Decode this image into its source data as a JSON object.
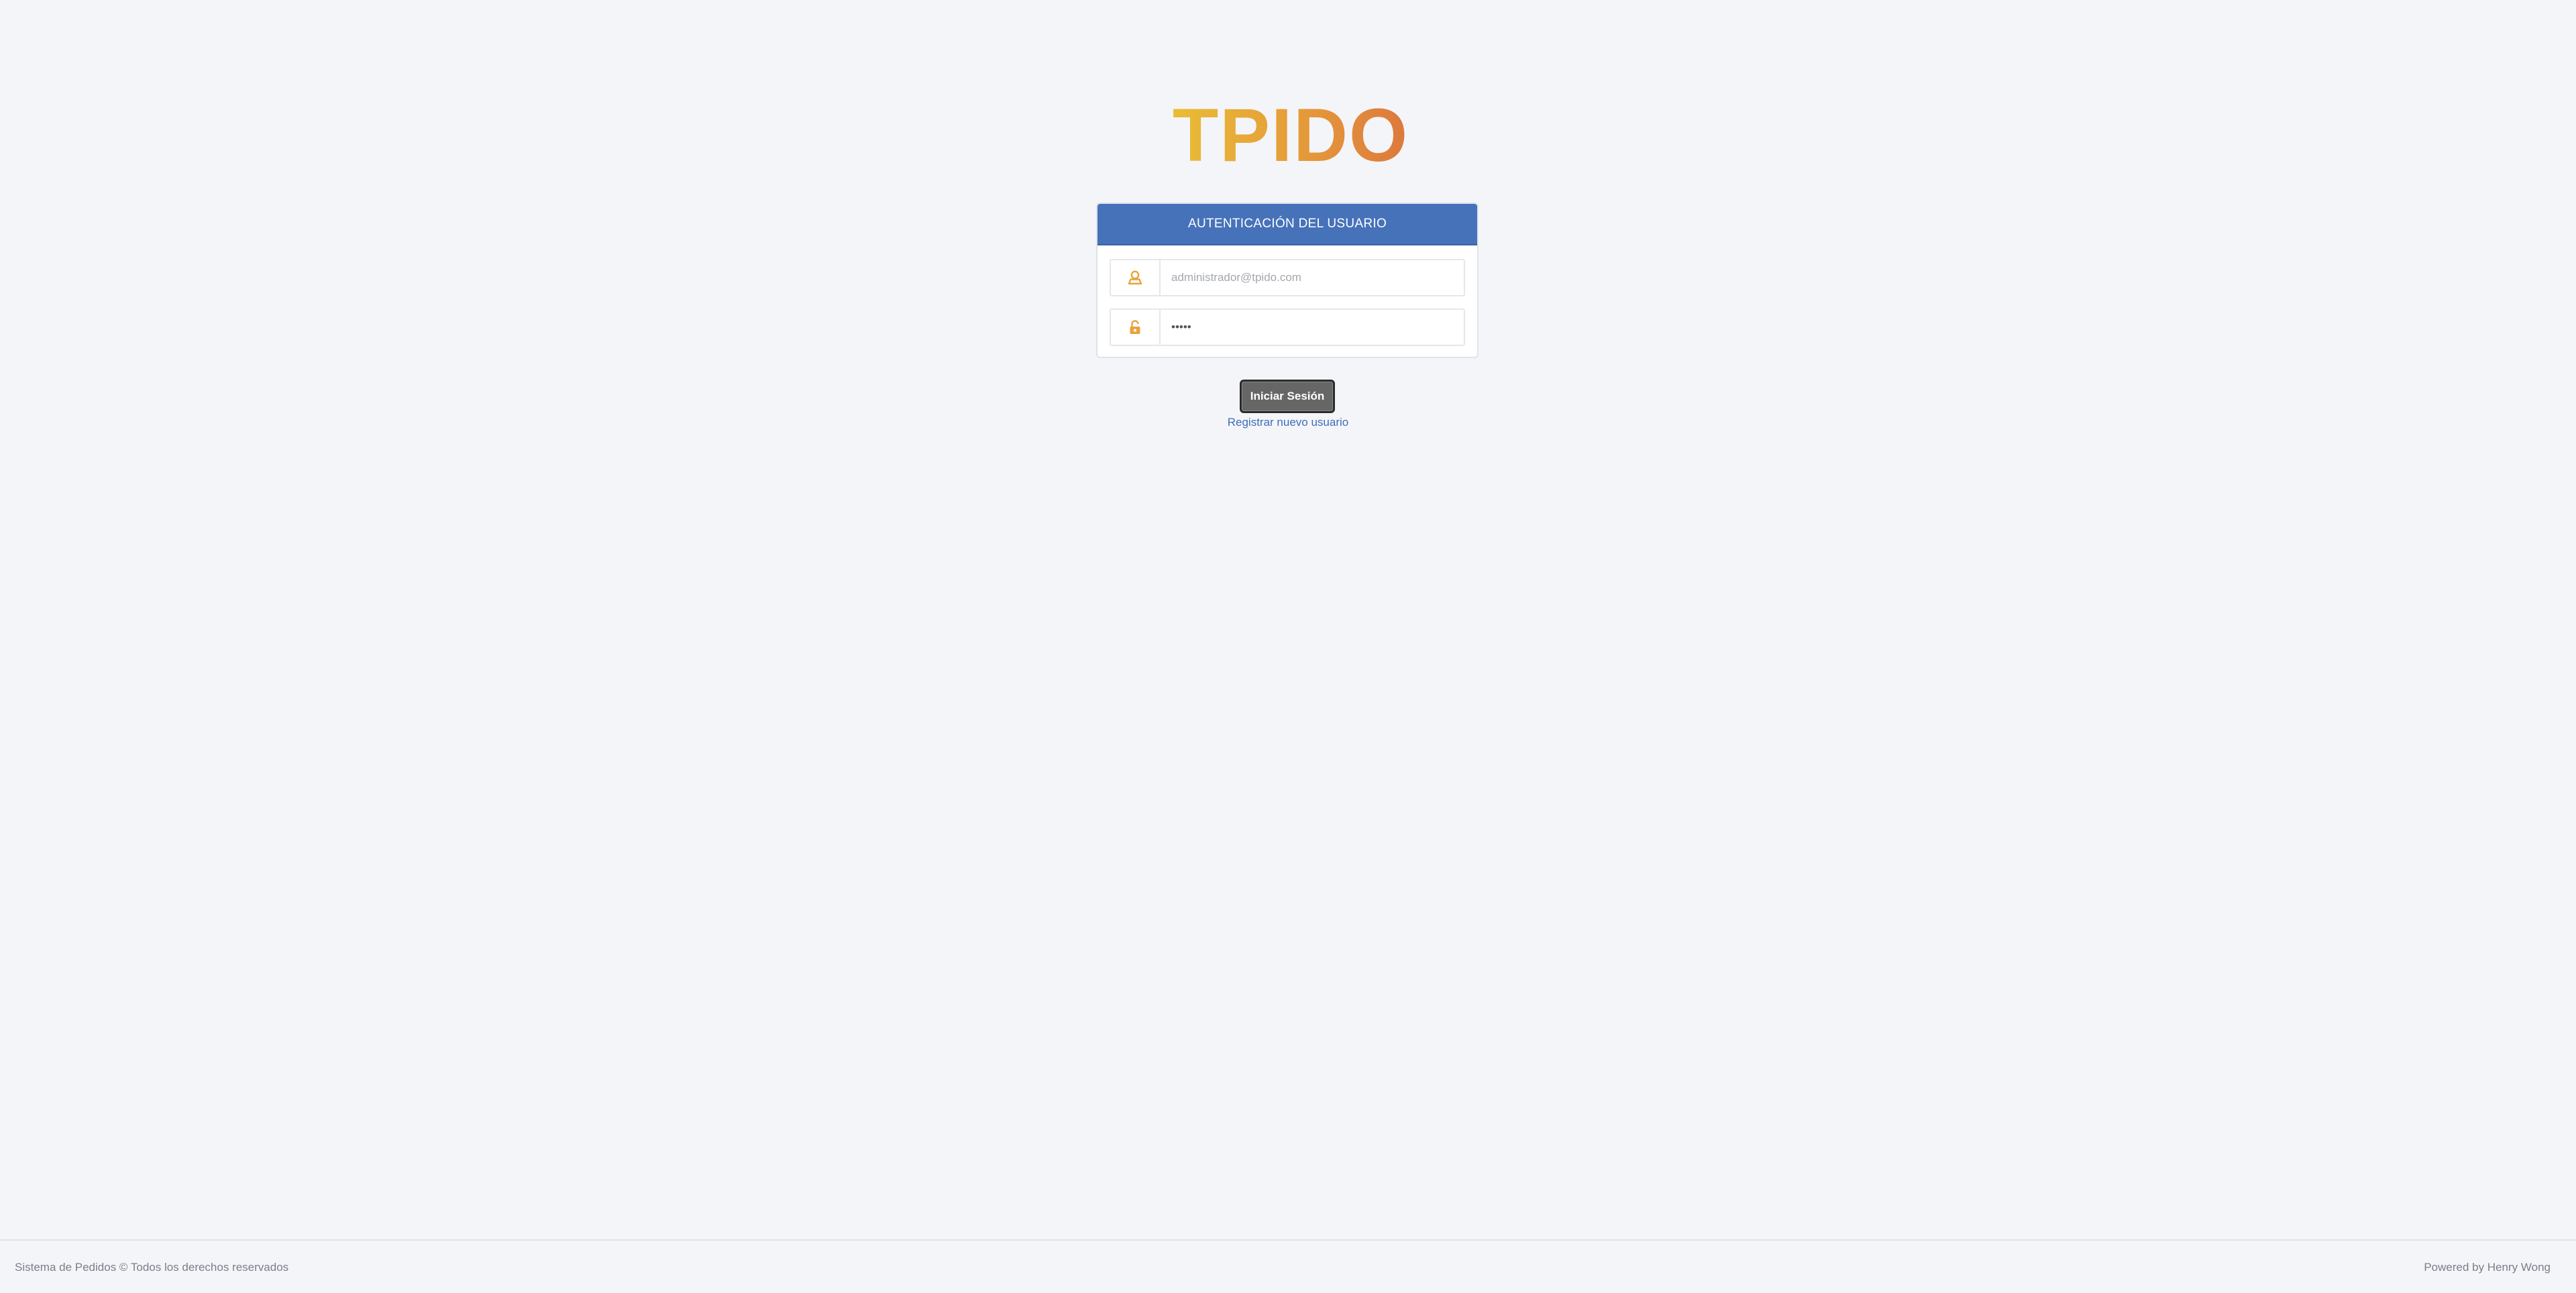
{
  "logo": {
    "text": "TPIDO",
    "colors": [
      "#e7b93a",
      "#e49138",
      "#dd7a3c"
    ]
  },
  "login_panel": {
    "header": "AUTENTICACIÓN DEL USUARIO",
    "email": {
      "icon": "user-icon",
      "value": "",
      "placeholder": "administrador@tpido.com"
    },
    "password": {
      "icon": "unlock-icon",
      "value": "•••••",
      "placeholder": ""
    },
    "icon_color": "#e9a33b",
    "header_color": "#4672ba"
  },
  "actions": {
    "login_button": "Iniciar Sesión",
    "register_link": "Registrar nuevo usuario"
  },
  "footer": {
    "left": "Sistema de Pedidos © Todos los derechos reservados",
    "right": "Powered by Henry Wong"
  }
}
